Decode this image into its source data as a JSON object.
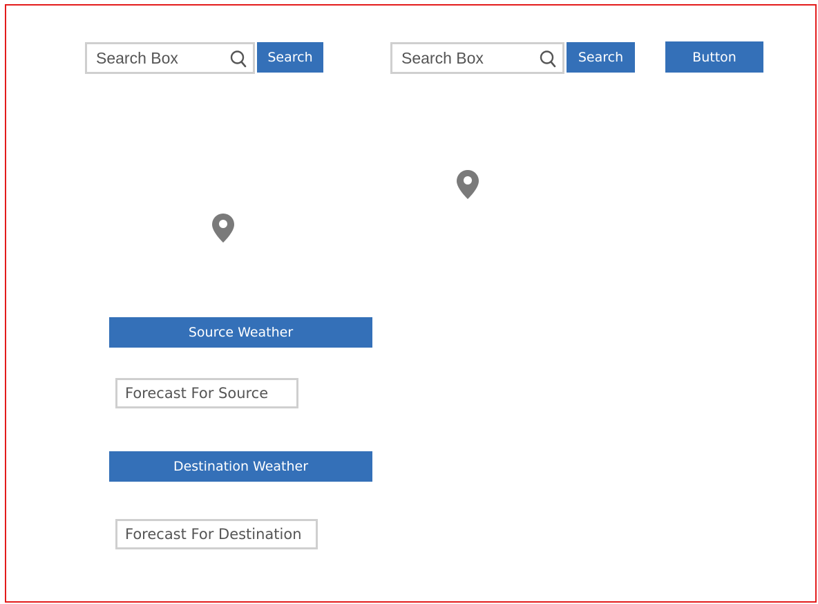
{
  "search_left": {
    "placeholder": "Search Box",
    "button_label": "Search",
    "icon": "search-icon"
  },
  "search_right": {
    "placeholder": "Search Box",
    "button_label": "Search",
    "icon": "search-icon"
  },
  "generic_button": {
    "label": "Button"
  },
  "map": {
    "markers": [
      {
        "icon": "map-pin-icon"
      },
      {
        "icon": "map-pin-icon"
      }
    ]
  },
  "source": {
    "header_label": "Source Weather",
    "forecast_text": "Forecast For Source"
  },
  "destination": {
    "header_label": "Destination Weather",
    "forecast_text": "Forecast For Destination"
  },
  "colors": {
    "frame_border": "#e31b1b",
    "button_bg": "#3470b8",
    "input_border": "#cfcfcf",
    "icon_gray": "#7a7a7a"
  }
}
